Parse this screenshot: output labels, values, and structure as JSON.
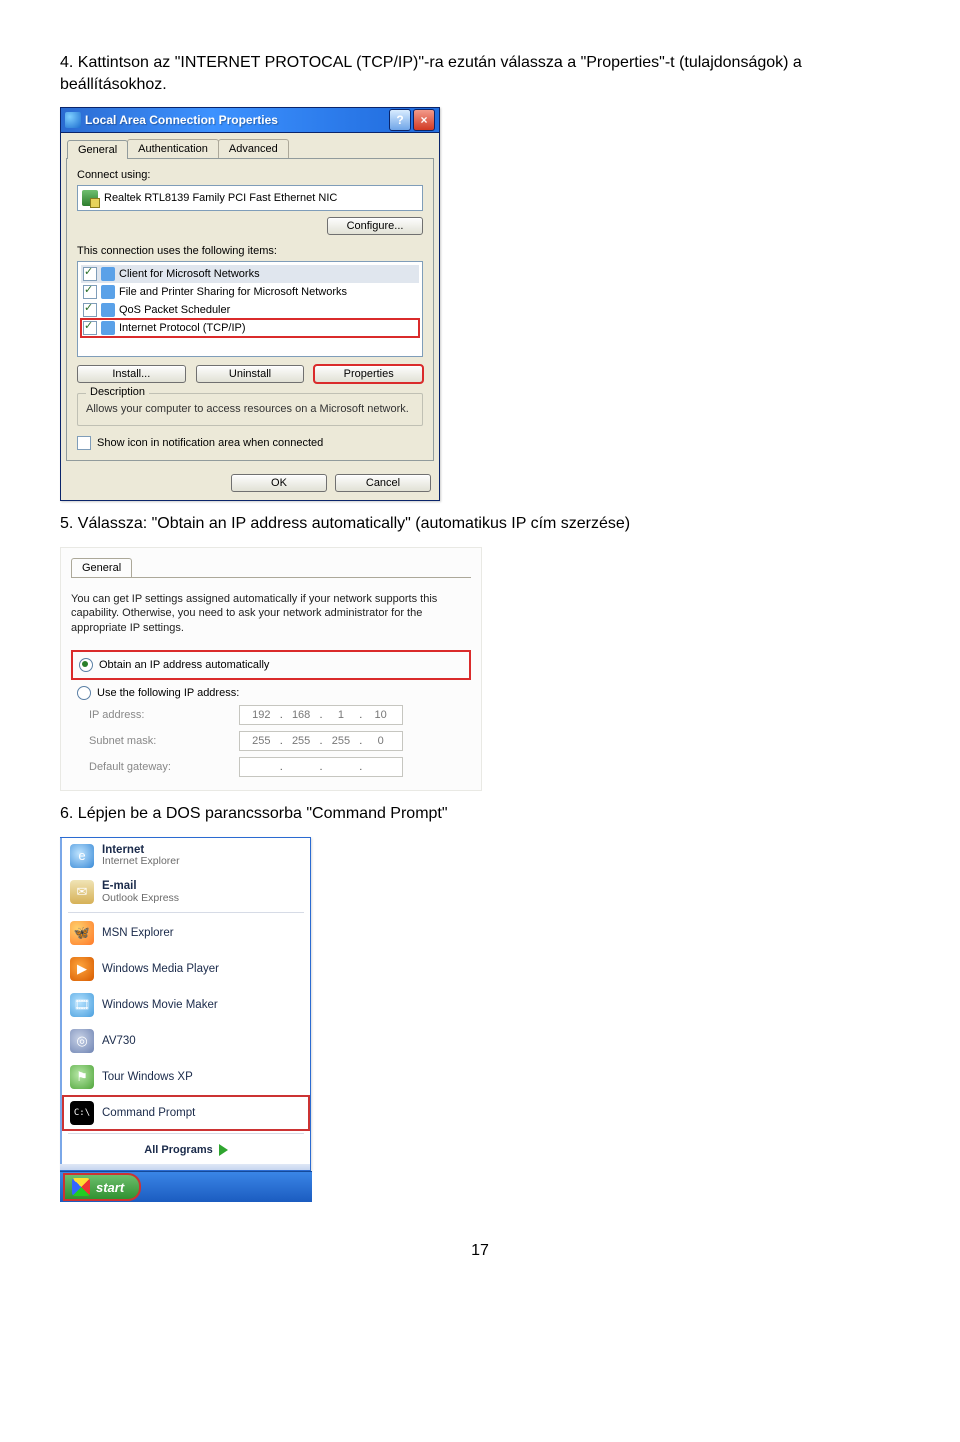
{
  "step4": {
    "text": "4. Kattintson az \"INTERNET PROTOCAL (TCP/IP)\"-ra ezután válassza a \"Properties\"-t (tulajdonságok) a beállításokhoz."
  },
  "propDialog": {
    "title": "Local Area Connection Properties",
    "tabs": {
      "general": "General",
      "auth": "Authentication",
      "adv": "Advanced"
    },
    "connectUsing": "Connect using:",
    "nic": "Realtek RTL8139 Family PCI Fast Ethernet NIC",
    "configureBtn": "Configure...",
    "usesLabel": "This connection uses the following items:",
    "items": [
      "Client for Microsoft Networks",
      "File and Printer Sharing for Microsoft Networks",
      "QoS Packet Scheduler",
      "Internet Protocol (TCP/IP)"
    ],
    "installBtn": "Install...",
    "uninstallBtn": "Uninstall",
    "propertiesBtn": "Properties",
    "descLegend": "Description",
    "descText": "Allows your computer to access resources on a Microsoft network.",
    "showIcon": "Show icon in notification area when connected",
    "okBtn": "OK",
    "cancelBtn": "Cancel"
  },
  "step5": {
    "text": "5. Válassza: \"Obtain an IP address automatically\" (automatikus IP cím szerzése)"
  },
  "ipPanel": {
    "tab": "General",
    "note": "You can get IP settings assigned automatically if your network supports this capability. Otherwise, you need to ask your network administrator for the appropriate IP settings.",
    "radioAuto": "Obtain an IP address automatically",
    "radioManual": "Use the following IP address:",
    "ipLabel": "IP address:",
    "ipValue": [
      "192",
      "168",
      "1",
      "10"
    ],
    "maskLabel": "Subnet mask:",
    "maskValue": [
      "255",
      "255",
      "255",
      "0"
    ],
    "gwLabel": "Default gateway:"
  },
  "step6": {
    "text": "6. Lépjen be a DOS parancssorba \"Command Prompt\""
  },
  "startMenu": {
    "items": [
      {
        "main": "Internet",
        "sub": "Internet Explorer",
        "cls": "ie"
      },
      {
        "main": "E-mail",
        "sub": "Outlook Express",
        "cls": "mail"
      },
      {
        "main": "MSN Explorer",
        "sub": "",
        "cls": "msn"
      },
      {
        "main": "Windows Media Player",
        "sub": "",
        "cls": "wmp"
      },
      {
        "main": "Windows Movie Maker",
        "sub": "",
        "cls": "wmm"
      },
      {
        "main": "AV730",
        "sub": "",
        "cls": "av"
      },
      {
        "main": "Tour Windows XP",
        "sub": "",
        "cls": "tour"
      },
      {
        "main": "Command Prompt",
        "sub": "",
        "cls": "cmd"
      }
    ],
    "allPrograms": "All Programs",
    "start": "start"
  },
  "pageNumber": "17"
}
